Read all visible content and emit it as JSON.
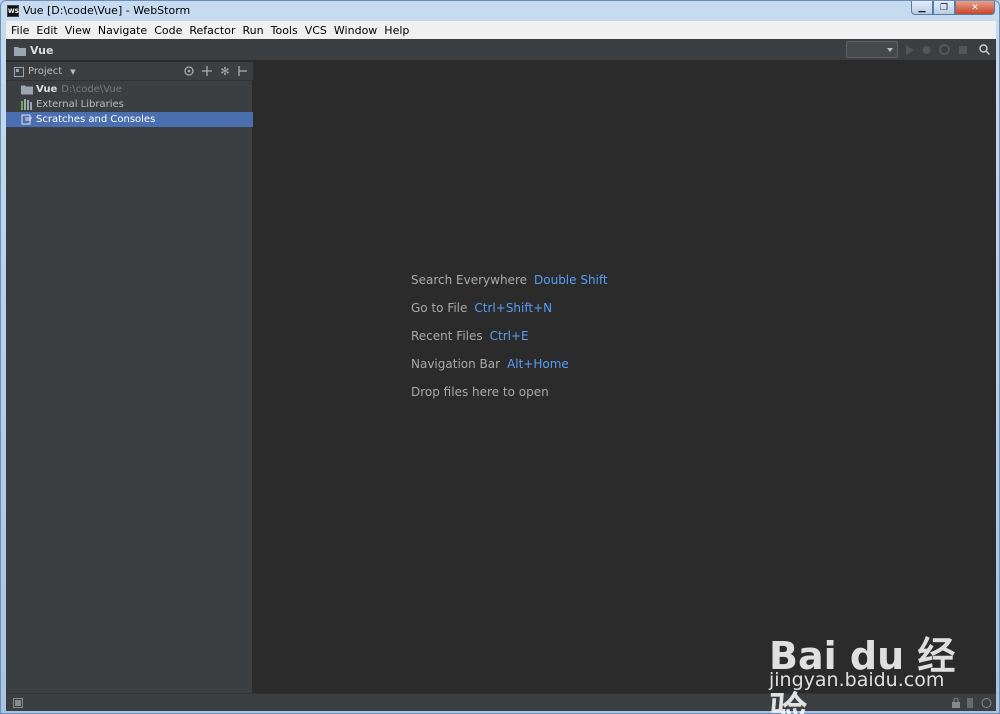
{
  "window": {
    "title": "Vue [D:\\code\\Vue] - WebStorm",
    "app_icon": "WS"
  },
  "menu": [
    "File",
    "Edit",
    "View",
    "Navigate",
    "Code",
    "Refactor",
    "Run",
    "Tools",
    "VCS",
    "Window",
    "Help"
  ],
  "navbar": {
    "project": "Vue"
  },
  "project_panel": {
    "title": "Project",
    "tree": [
      {
        "name": "Vue",
        "path": "D:\\code\\Vue"
      },
      {
        "name": "External Libraries"
      },
      {
        "name": "Scratches and Consoles"
      }
    ]
  },
  "editor": {
    "hints": [
      {
        "label": "Search Everywhere",
        "shortcut": "Double Shift"
      },
      {
        "label": "Go to File",
        "shortcut": "Ctrl+Shift+N"
      },
      {
        "label": "Recent Files",
        "shortcut": "Ctrl+E"
      },
      {
        "label": "Navigation Bar",
        "shortcut": "Alt+Home"
      },
      {
        "label": "Drop files here to open",
        "shortcut": ""
      }
    ]
  },
  "watermark": {
    "logo": "Bai du 经验",
    "url": "jingyan.baidu.com"
  },
  "colors": {
    "accent": "#589df6",
    "selection": "#4b6eaf",
    "panel": "#3c3f41",
    "editor": "#2b2b2b"
  }
}
